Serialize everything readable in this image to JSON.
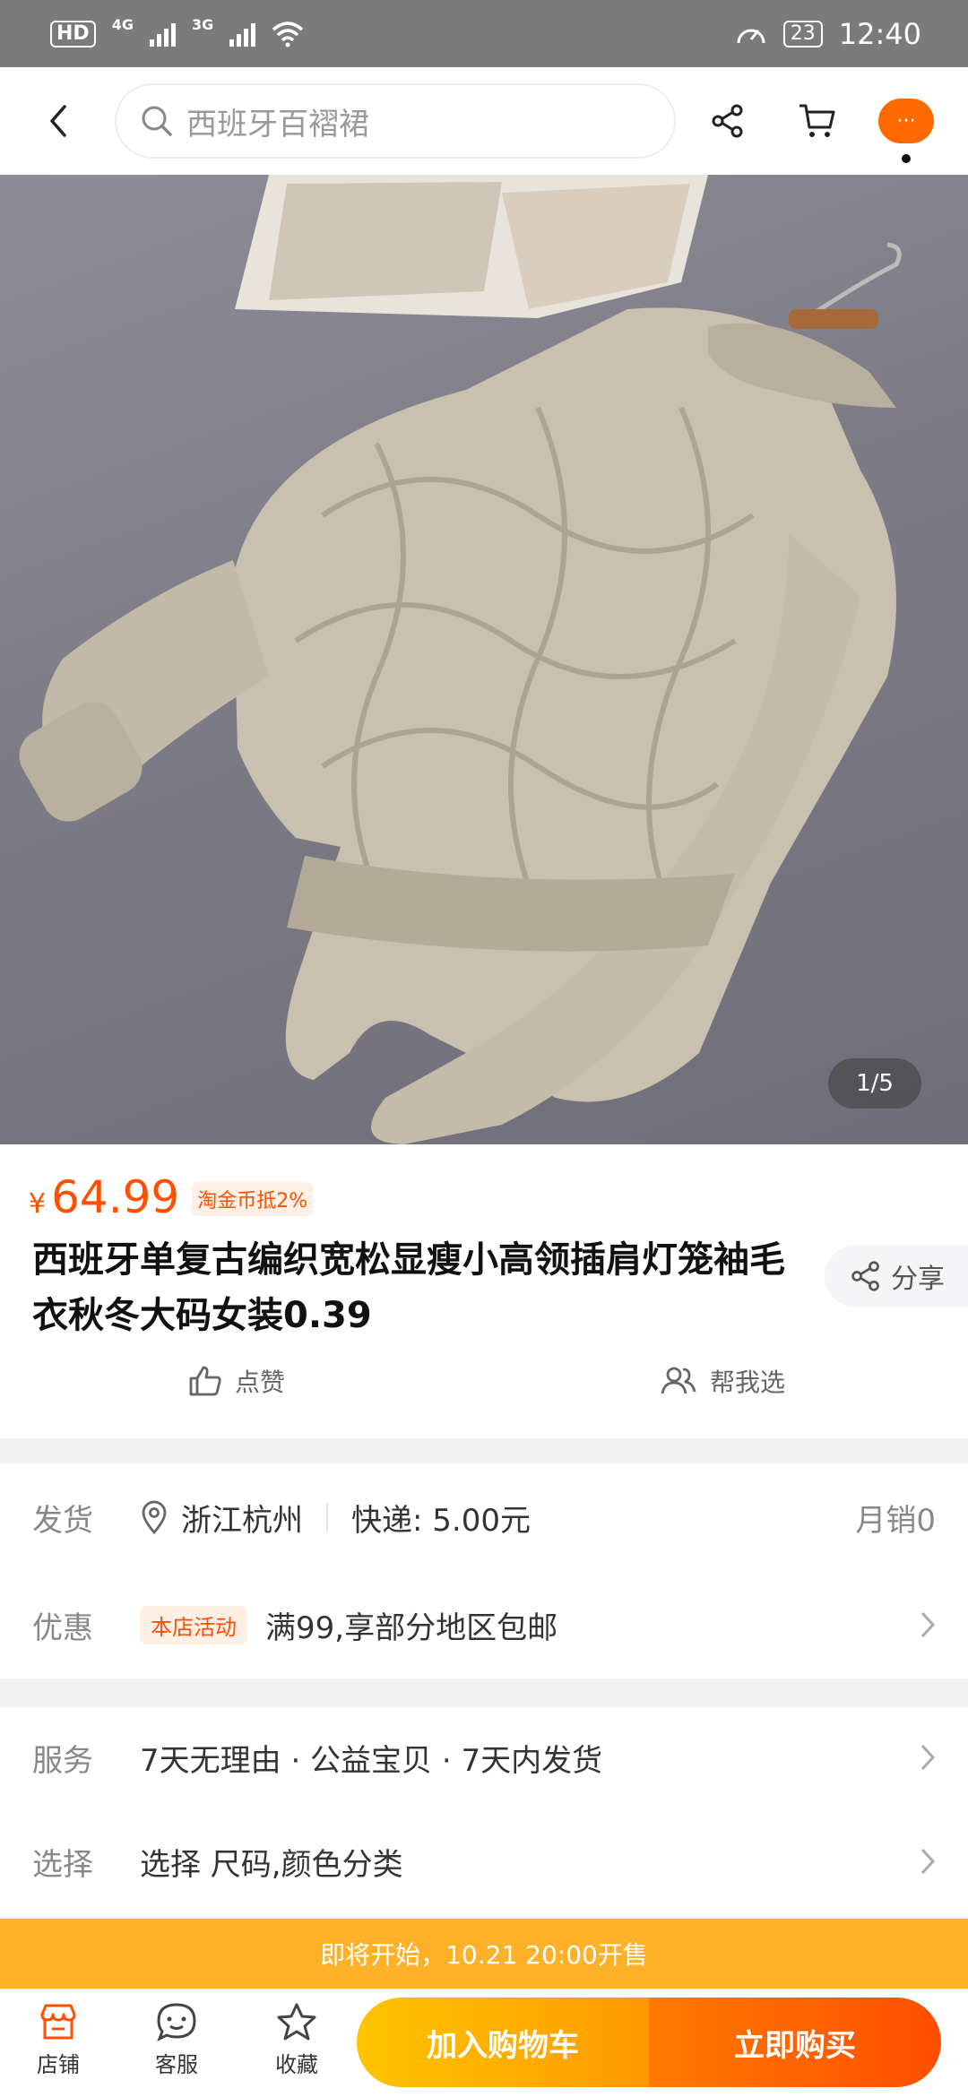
{
  "status_bar": {
    "hd": "HD",
    "sim": "1",
    "net1": "4G",
    "net2": "3G",
    "battery": "23",
    "time": "12:40"
  },
  "top_nav": {
    "search_placeholder": "西班牙百褶裙",
    "more_glyph": "···"
  },
  "gallery": {
    "pager": "1/5"
  },
  "product": {
    "currency": "¥",
    "price": "64.99",
    "coin_tag": "淘金币抵2%",
    "title": "西班牙单复古编织宽松显瘦小高领插肩灯笼袖毛衣秋冬大码女装0.39",
    "share_label": "分享",
    "like_label": "点赞",
    "help_choose_label": "帮我选"
  },
  "delivery": {
    "label": "发货",
    "location": "浙江杭州",
    "shipping": "快递: 5.00元",
    "monthly_sales": "月销0"
  },
  "promo": {
    "label": "优惠",
    "tag": "本店活动",
    "text": "满99,享部分地区包邮"
  },
  "service": {
    "label": "服务",
    "text": "7天无理由 · 公益宝贝 · 7天内发货"
  },
  "choose": {
    "label": "选择",
    "text": "选择 尺码,颜色分类"
  },
  "presale_banner": "即将开始，10.21 20:00开售",
  "bottom_bar": {
    "shop": "店铺",
    "service": "客服",
    "favorite": "收藏",
    "add_to_cart": "加入购物车",
    "buy_now": "立即购买"
  },
  "colors": {
    "accent": "#ff5000",
    "status_bar": "#7b7b7b",
    "presale": "#ffb12a",
    "cart_gradient": [
      "#ffc400",
      "#ff9a00"
    ],
    "buy_gradient": [
      "#ff7a00",
      "#ff4e00"
    ]
  },
  "icons": [
    "back-arrow-icon",
    "search-icon",
    "share-icon",
    "cart-icon",
    "more-icon",
    "location-pin-icon",
    "thumbs-up-icon",
    "users-icon",
    "chevron-right-icon",
    "shop-icon",
    "chat-icon",
    "star-icon"
  ]
}
